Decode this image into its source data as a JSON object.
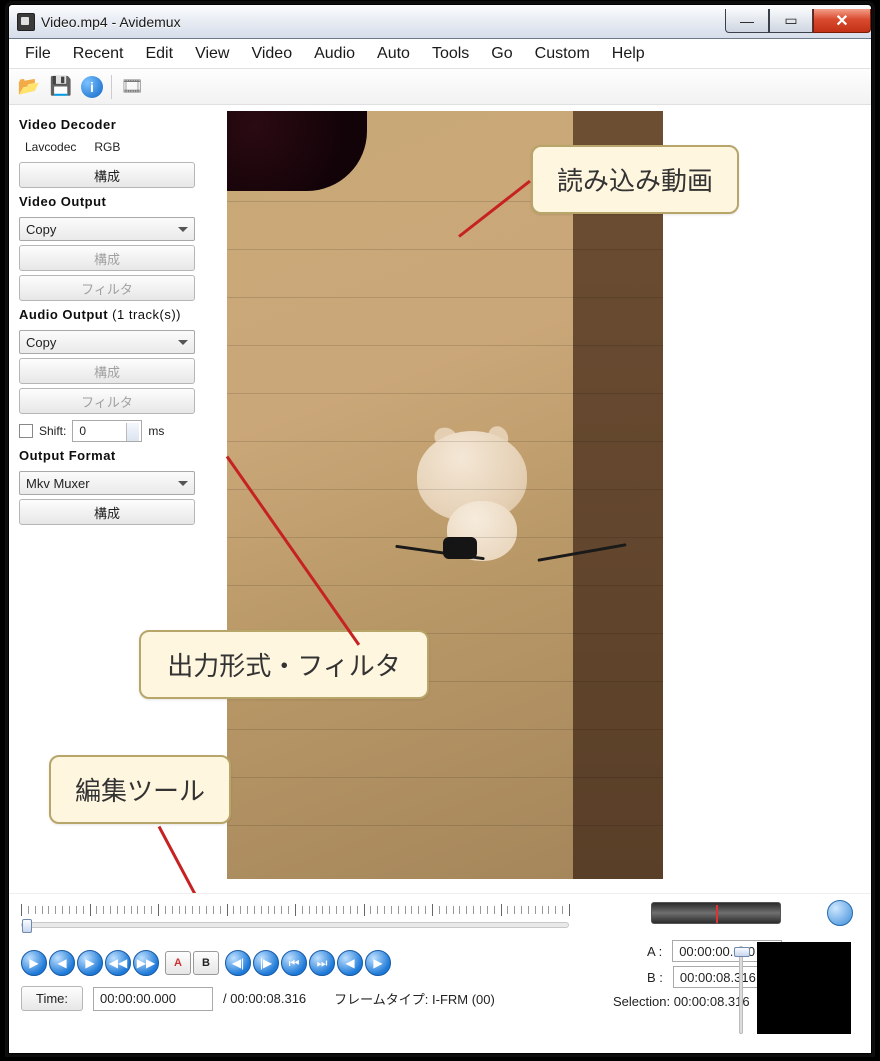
{
  "window": {
    "title": "Video.mp4 - Avidemux"
  },
  "menu": {
    "file": "File",
    "recent": "Recent",
    "edit": "Edit",
    "view": "View",
    "video": "Video",
    "audio": "Audio",
    "auto": "Auto",
    "tools": "Tools",
    "go": "Go",
    "custom": "Custom",
    "help": "Help"
  },
  "sidebar": {
    "video_decoder": {
      "title": "Video Decoder",
      "codec": "Lavcodec",
      "mode": "RGB",
      "configure": "構成"
    },
    "video_output": {
      "title": "Video Output",
      "value": "Copy",
      "configure": "構成",
      "filter": "フィルタ"
    },
    "audio_output": {
      "title": "Audio Output",
      "tracks": "(1 track(s))",
      "value": "Copy",
      "configure": "構成",
      "filter": "フィルタ",
      "shift_label": "Shift:",
      "shift_value": "0",
      "shift_unit": "ms"
    },
    "output_format": {
      "title": "Output Format",
      "value": "Mkv Muxer",
      "configure": "構成"
    }
  },
  "callouts": {
    "loaded_video": "読み込み動画",
    "output_filters": "出力形式・フィルタ",
    "edit_tools": "編集ツール"
  },
  "transport": {
    "time_btn": "Time:",
    "time_value": "00:00:00.000",
    "total": "/ 00:00:08.316",
    "frametype": "フレームタイプ: I-FRM (00)",
    "a_label": "A :",
    "a_value": "00:00:00.000",
    "b_label": "B :",
    "b_value": "00:00:08.316",
    "selection_label": "Selection:",
    "selection_value": "00:00:08.316"
  },
  "icons": {
    "play": "▶",
    "prev": "◀",
    "next": "▶",
    "rwd": "⏮",
    "fwd": "⏭",
    "step_back": "◀|",
    "step_fwd": "|▶",
    "kf_prev": "◀◀",
    "kf_next": "▶▶",
    "black_prev": "◀",
    "black_next": "▶"
  }
}
